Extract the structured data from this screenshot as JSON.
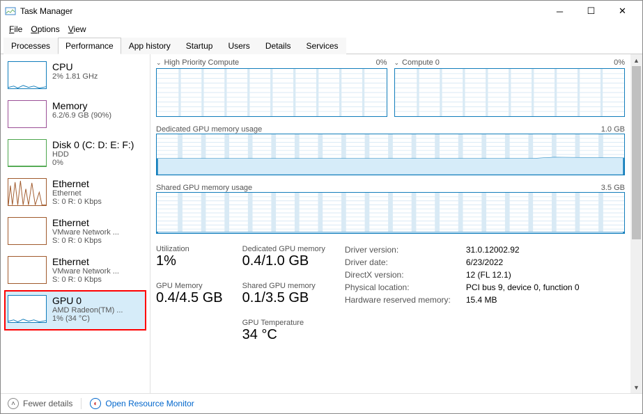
{
  "window": {
    "title": "Task Manager"
  },
  "menu": {
    "file": "File",
    "options": "Options",
    "view": "View"
  },
  "tabs": [
    "Processes",
    "Performance",
    "App history",
    "Startup",
    "Users",
    "Details",
    "Services"
  ],
  "active_tab": 1,
  "sidebar": [
    {
      "name": "cpu",
      "title": "CPU",
      "sub1": "2% 1.81 GHz"
    },
    {
      "name": "memory",
      "title": "Memory",
      "sub1": "6.2/6.9 GB (90%)"
    },
    {
      "name": "disk0",
      "title": "Disk 0 (C: D: E: F:)",
      "sub1": "HDD",
      "sub2": "0%"
    },
    {
      "name": "eth0",
      "title": "Ethernet",
      "sub1": "Ethernet",
      "sub2": "S: 0 R: 0 Kbps"
    },
    {
      "name": "eth1",
      "title": "Ethernet",
      "sub1": "VMware Network ...",
      "sub2": "S: 0 R: 0 Kbps"
    },
    {
      "name": "eth2",
      "title": "Ethernet",
      "sub1": "VMware Network ...",
      "sub2": "S: 0 R: 0 Kbps"
    },
    {
      "name": "gpu0",
      "title": "GPU 0",
      "sub1": "AMD Radeon(TM) ...",
      "sub2": "1% (34 °C)"
    }
  ],
  "selected_sidebar": 6,
  "graphs": {
    "hp": {
      "label": "High Priority Compute",
      "pct": "0%"
    },
    "c0": {
      "label": "Compute 0",
      "pct": "0%"
    },
    "ded": {
      "label": "Dedicated GPU memory usage",
      "max": "1.0 GB"
    },
    "shr": {
      "label": "Shared GPU memory usage",
      "max": "3.5 GB"
    }
  },
  "stats": {
    "col1": [
      {
        "label": "Utilization",
        "value": "1%"
      },
      {
        "label": "GPU Memory",
        "value": "0.4/4.5 GB"
      }
    ],
    "col2": [
      {
        "label": "Dedicated GPU memory",
        "value": "0.4/1.0 GB"
      },
      {
        "label": "Shared GPU memory",
        "value": "0.1/3.5 GB"
      },
      {
        "label": "GPU Temperature",
        "value": "34 °C"
      }
    ]
  },
  "info": [
    {
      "key": "Driver version:",
      "val": "31.0.12002.92"
    },
    {
      "key": "Driver date:",
      "val": "6/23/2022"
    },
    {
      "key": "DirectX version:",
      "val": "12 (FL 12.1)"
    },
    {
      "key": "Physical location:",
      "val": "PCI bus 9, device 0, function 0"
    },
    {
      "key": "Hardware reserved memory:",
      "val": "15.4 MB"
    }
  ],
  "footer": {
    "fewer": "Fewer details",
    "orm": "Open Resource Monitor"
  },
  "chart_data": [
    {
      "type": "area",
      "name": "High Priority Compute",
      "ylim": [
        0,
        100
      ],
      "values": [
        0,
        0,
        0,
        0,
        0,
        0,
        0,
        0,
        0,
        0
      ]
    },
    {
      "type": "area",
      "name": "Compute 0",
      "ylim": [
        0,
        100
      ],
      "values": [
        0,
        0,
        0,
        0,
        0,
        0,
        0,
        0,
        0,
        0
      ]
    },
    {
      "type": "area",
      "name": "Dedicated GPU memory usage",
      "ylabel": "GB",
      "ylim": [
        0,
        1.0
      ],
      "values": [
        0.4,
        0.4,
        0.4,
        0.4,
        0.4,
        0.4,
        0.4,
        0.4,
        0.4,
        0.4
      ]
    },
    {
      "type": "area",
      "name": "Shared GPU memory usage",
      "ylabel": "GB",
      "ylim": [
        0,
        3.5
      ],
      "values": [
        0.1,
        0.1,
        0.1,
        0.1,
        0.1,
        0.1,
        0.1,
        0.1,
        0.1,
        0.1
      ]
    }
  ]
}
